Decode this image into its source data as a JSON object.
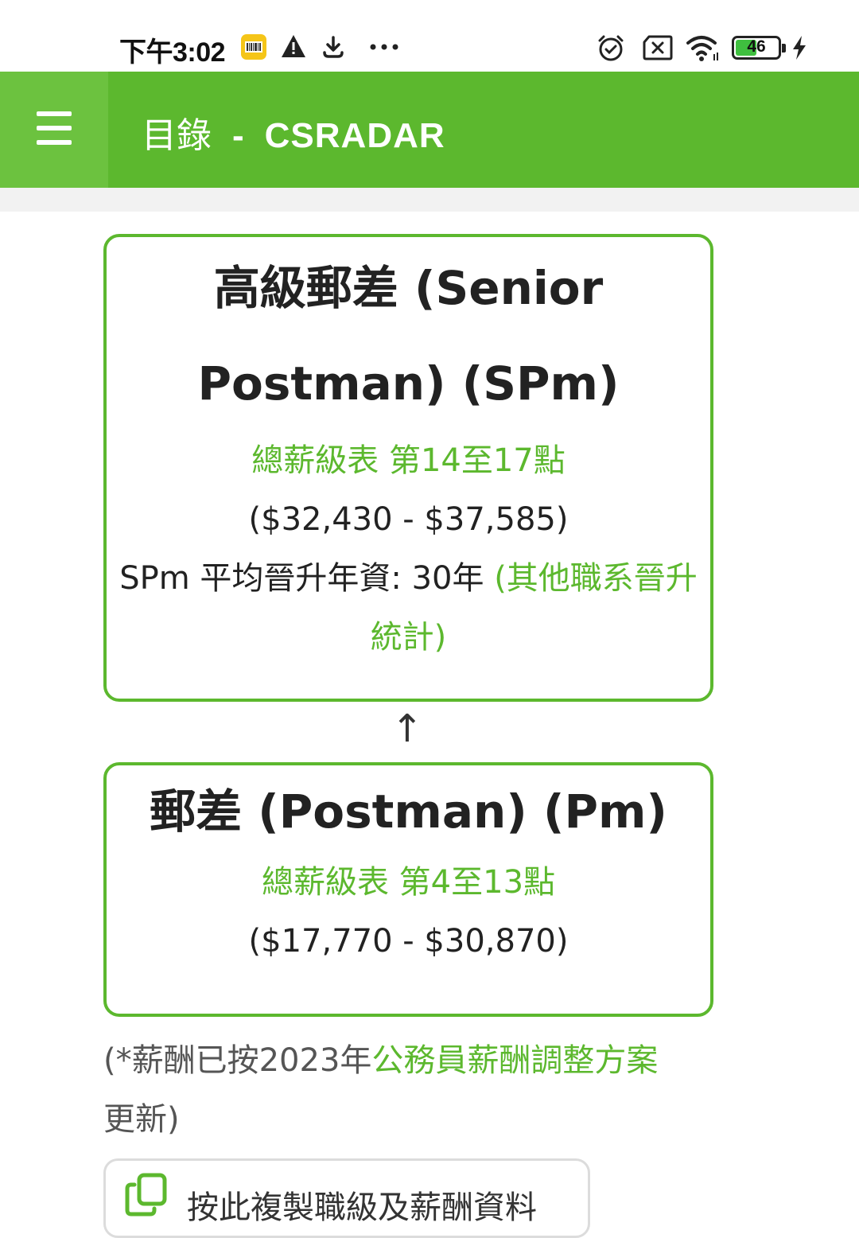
{
  "status_bar": {
    "time": "下午3:02",
    "battery_level": "46",
    "icons": [
      "barcode-app-icon",
      "warning-icon",
      "download-icon",
      "more-dots-icon",
      "alarm-icon",
      "sim-off-icon",
      "wifi-icon",
      "battery-icon",
      "charging-icon"
    ]
  },
  "app_bar": {
    "menu_icon": "hamburger-menu-icon",
    "title_prefix": "目錄",
    "title_separator": "-",
    "title_brand": "CSRADAR",
    "color": "#5cb82e"
  },
  "ranks": [
    {
      "title": "高級郵差 (Senior Postman) (SPm)",
      "pay_scale": "總薪級表 第14至17點",
      "pay_range": "($32,430 - $37,585)",
      "promotion_text": "SPm 平均晉升年資: 30年 ",
      "promotion_link": "(其他職系晉升統計)"
    },
    {
      "title": "郵差 (Postman) (Pm)",
      "pay_scale": "總薪級表 第4至13點",
      "pay_range": "($17,770 - $30,870)"
    }
  ],
  "promotion_arrow": "↑",
  "note": {
    "prefix": "(*薪酬已按2023年",
    "link": "公務員薪酬調整方案",
    "suffix": "更新)"
  },
  "copy_button": {
    "icon": "copy-icon",
    "label": "按此複製職級及薪酬資料"
  },
  "colors": {
    "accent": "#5cb82e",
    "menu_bg": "#6cc23f",
    "text": "#222222"
  }
}
